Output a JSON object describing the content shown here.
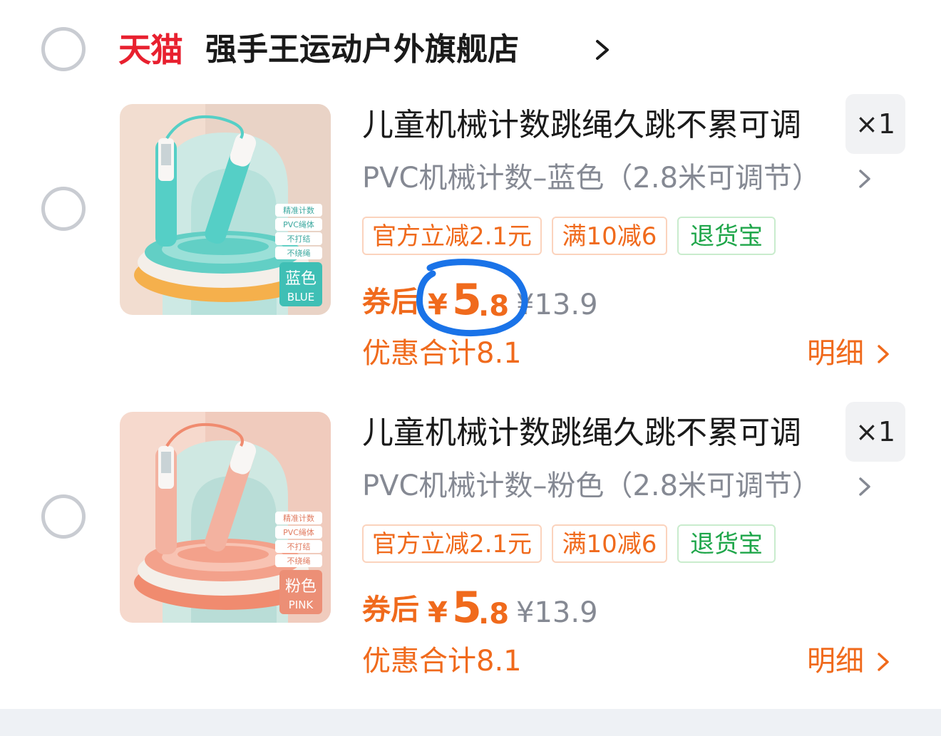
{
  "shop": {
    "platform": "天猫",
    "name": "强手王运动户外旗舰店"
  },
  "items": [
    {
      "title": "儿童机械计数跳绳久跳不累可调",
      "quantity": "×1",
      "sku": "PVC机械计数–蓝色（2.8米可调节）",
      "tags": [
        "官方立减2.1元",
        "满10减6",
        "退货宝"
      ],
      "price_label": "券后",
      "price_yen": "¥",
      "price_int": "5",
      "price_dec": ".8",
      "original_price": "¥13.9",
      "discount_total": "优惠合计8.1",
      "detail_link": "明细",
      "image": {
        "color_name_cn": "蓝色",
        "color_name_en": "BLUE",
        "features": [
          "精准计数",
          "PVC绳体",
          "不打结",
          "不绕绳"
        ],
        "accent": "#55cfc6"
      }
    },
    {
      "title": "儿童机械计数跳绳久跳不累可调",
      "quantity": "×1",
      "sku": "PVC机械计数–粉色（2.8米可调节）",
      "tags": [
        "官方立减2.1元",
        "满10减6",
        "退货宝"
      ],
      "price_label": "券后",
      "price_yen": "¥",
      "price_int": "5",
      "price_dec": ".8",
      "original_price": "¥13.9",
      "discount_total": "优惠合计8.1",
      "detail_link": "明细",
      "image": {
        "color_name_cn": "粉色",
        "color_name_en": "PINK",
        "features": [
          "精准计数",
          "PVC绳体",
          "不打结",
          "不绕绳"
        ],
        "accent": "#f0a58e"
      }
    }
  ],
  "colors": {
    "tmall_red": "#e8202f",
    "price_orange": "#f06a1c",
    "green_tag": "#1fa64a",
    "annotation_blue": "#1a73e8"
  }
}
